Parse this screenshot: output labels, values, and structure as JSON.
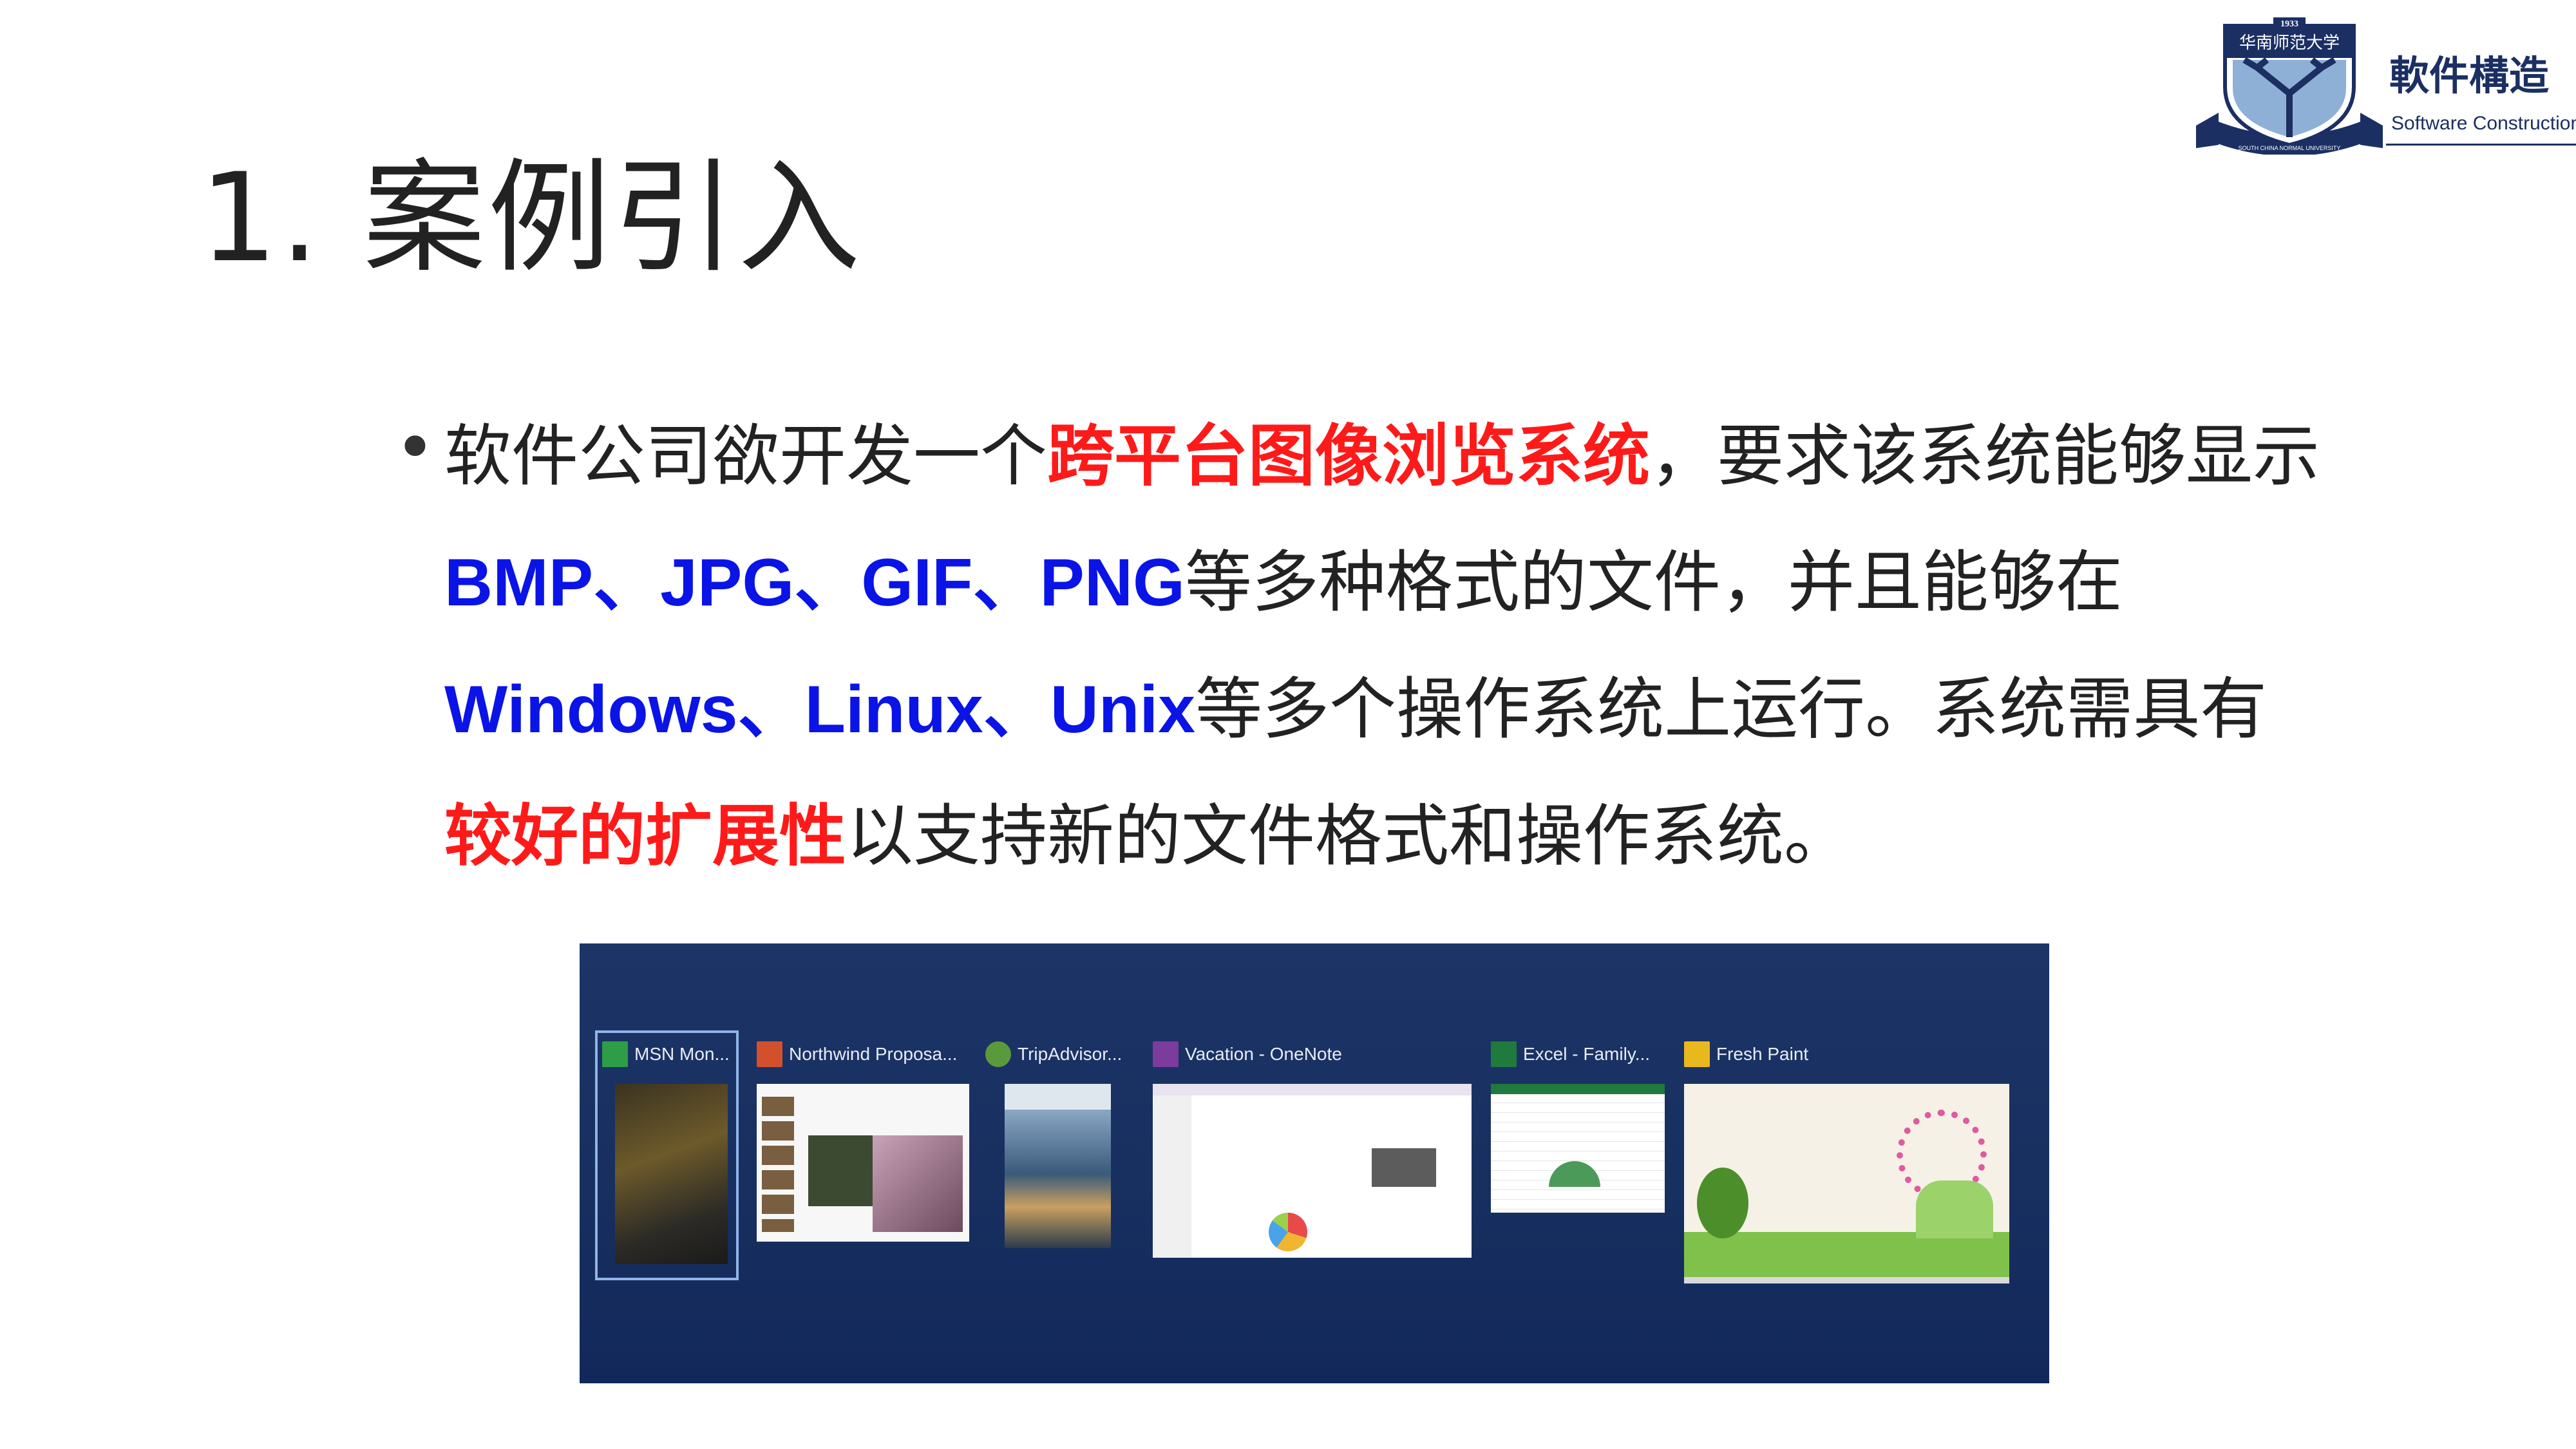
{
  "slide": {
    "title": "1. 案例引入",
    "logo": {
      "year": "1933",
      "university_name": "华南师范大学",
      "university_en": "SOUTH CHINA NORMAL UNIVERSITY",
      "course_cn": "軟件構造",
      "course_en": "Software Construction"
    },
    "bullet": {
      "marker": "•",
      "segments": [
        {
          "text": "软件公司欲开发一个",
          "style": "normal"
        },
        {
          "text": "跨平台图像浏览系统",
          "style": "red"
        },
        {
          "text": "，要求该系统能够显示",
          "style": "normal"
        },
        {
          "text": "BMP、JPG、GIF、PNG",
          "style": "blue"
        },
        {
          "text": "等多种格式的文件，并且能够在",
          "style": "normal"
        },
        {
          "text": "Windows、Linux、Unix",
          "style": "blue"
        },
        {
          "text": "等多个操作系统上运行。系统需具有",
          "style": "normal"
        },
        {
          "text": "较好的扩展性",
          "style": "red"
        },
        {
          "text": "以支持新的文件格式和操作系统。",
          "style": "normal"
        }
      ]
    },
    "screenshot": {
      "apps": [
        {
          "label": "MSN Mon...",
          "icon": "chart-icon",
          "icon_color": "#2e9d48"
        },
        {
          "label": "Northwind Proposa...",
          "icon": "powerpoint-icon",
          "icon_color": "#d2502b"
        },
        {
          "label": "TripAdvisor...",
          "icon": "owl-icon",
          "icon_color": "#5b9a3c"
        },
        {
          "label": "Vacation - OneNote",
          "icon": "onenote-icon",
          "icon_color": "#7b3c9e"
        },
        {
          "label": "Excel - Family...",
          "icon": "excel-icon",
          "icon_color": "#1f7a3d"
        },
        {
          "label": "Fresh Paint",
          "icon": "paint-icon",
          "icon_color": "#e8b81c"
        }
      ]
    },
    "colors": {
      "highlight_red": "#ff1a1a",
      "highlight_blue": "#0a14e6",
      "switcher_bg": "#173060",
      "logo_navy": "#1b2f63"
    }
  }
}
